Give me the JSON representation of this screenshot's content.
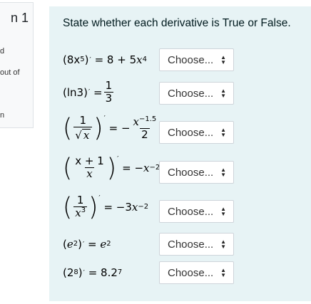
{
  "info": {
    "title": "n 1",
    "line1": "d",
    "line2": "out of",
    "line3": "n"
  },
  "question": {
    "prompt": "State whether each derivative is True or False.",
    "rows": [
      {
        "id": "r1",
        "select_value": "Choose..."
      },
      {
        "id": "r2",
        "select_value": "Choose..."
      },
      {
        "id": "r3",
        "select_value": "Choose..."
      },
      {
        "id": "r4",
        "select_value": "Choose..."
      },
      {
        "id": "r5",
        "select_value": "Choose..."
      },
      {
        "id": "r6",
        "select_value": "Choose..."
      },
      {
        "id": "r7",
        "select_value": "Choose..."
      }
    ],
    "expressions": {
      "r1": {
        "base": "8x",
        "exp": "5",
        "rhs_a": "= 8 + 5",
        "rhs_x": "x",
        "rhs_exp": "4"
      },
      "r2": {
        "base": "ln3",
        "rhs": "=",
        "num": "1",
        "den": "3"
      },
      "r3": {
        "num": "1",
        "den_x": "x",
        "rhs": "= −",
        "rnum_x": "x",
        "rnum_exp": "−1.5",
        "rden": "2"
      },
      "r4": {
        "num": "x + 1",
        "den_x": "x",
        "rhs": "= −",
        "rhs_x": "x",
        "rhs_exp": "−2"
      },
      "r5": {
        "num": "1",
        "den_x": "x",
        "den_exp": "3",
        "rhs": "= −3",
        "rhs_x": "x",
        "rhs_exp": "−2"
      },
      "r6": {
        "base": "e",
        "exp": "2",
        "rhs": "=",
        "rhs_b": "e",
        "rhs_exp": "2"
      },
      "r7": {
        "base": "2",
        "exp": "8",
        "rhs": "= 8.2",
        "rhs_exp": "7"
      }
    },
    "prime": "′"
  }
}
